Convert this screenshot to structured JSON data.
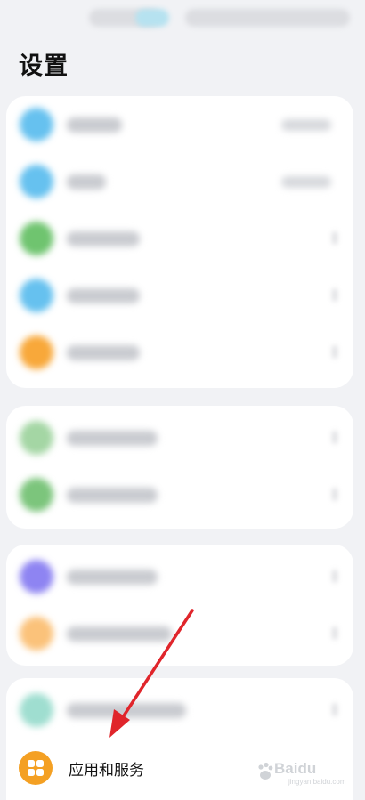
{
  "header": {
    "title": "设置"
  },
  "apps_services": {
    "label": "应用和服务",
    "icon": "apps-grid-icon",
    "icon_color": "#f4a023"
  },
  "watermark": {
    "brand": "Baidu",
    "sub": "jingyan.baidu.com"
  },
  "annotation": {
    "arrow_color": "#e0252b"
  },
  "colors": {
    "background": "#f1f2f5",
    "card": "#ffffff"
  }
}
